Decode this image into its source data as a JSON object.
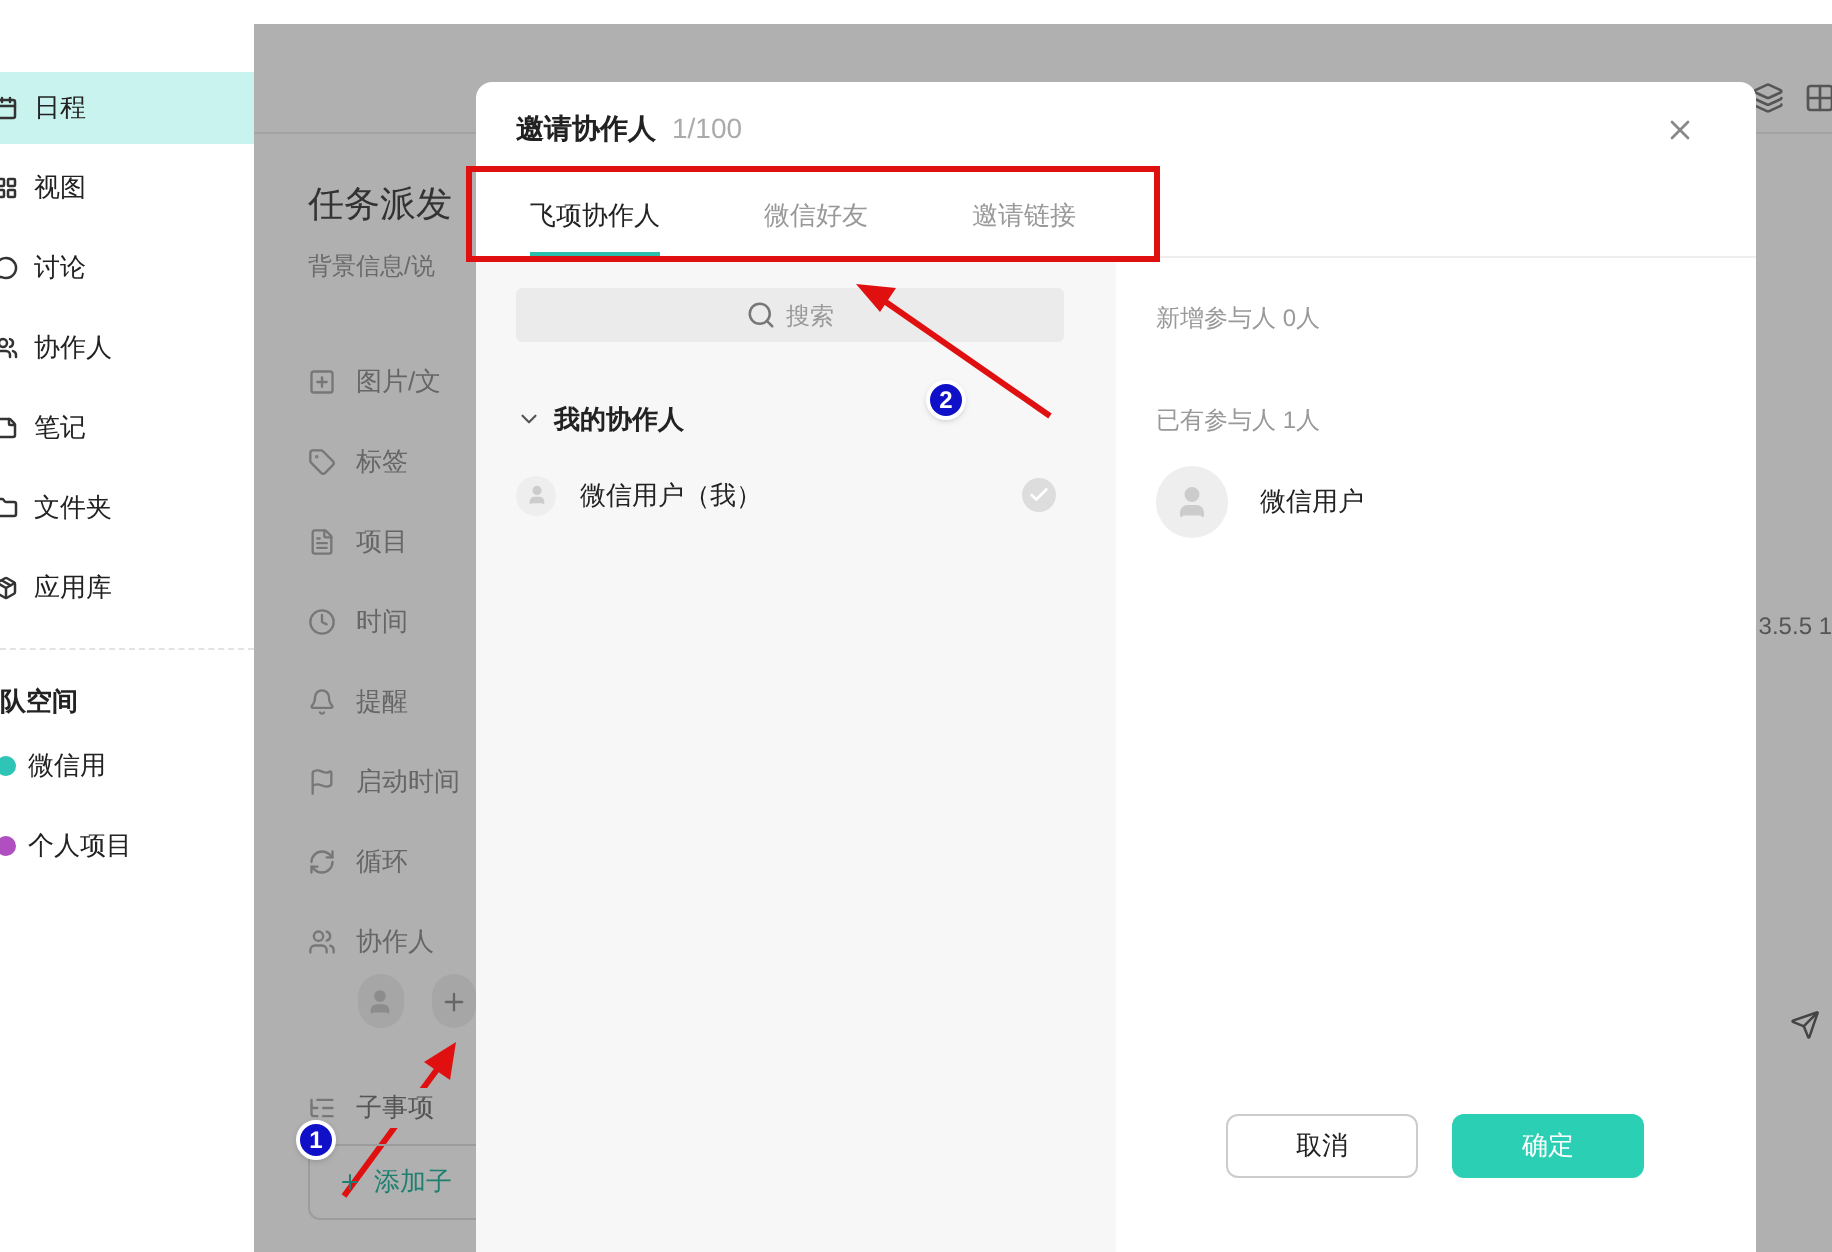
{
  "sidebar": {
    "items": [
      {
        "label": "日程",
        "kind": "calendar",
        "selected": true
      },
      {
        "label": "视图",
        "kind": "view",
        "selected": false
      },
      {
        "label": "讨论",
        "kind": "chat",
        "selected": false
      },
      {
        "label": "协作人",
        "kind": "people",
        "selected": false
      },
      {
        "label": "笔记",
        "kind": "note",
        "selected": false
      },
      {
        "label": "文件夹",
        "kind": "folder",
        "selected": false
      },
      {
        "label": "应用库",
        "kind": "apps",
        "selected": false
      }
    ],
    "section_title": "队空间",
    "projects": [
      {
        "label": "微信用",
        "color": "#2ec4b6"
      },
      {
        "label": "个人项目",
        "color": "#b04fc0"
      }
    ]
  },
  "task_panel": {
    "title": "任务派发",
    "description_placeholder": "背景信息/说",
    "fields": [
      {
        "label": "图片/文",
        "kind": "attachment"
      },
      {
        "label": "标签",
        "kind": "tag"
      },
      {
        "label": "项目",
        "kind": "project"
      },
      {
        "label": "时间",
        "kind": "time"
      },
      {
        "label": "提醒",
        "kind": "reminder"
      },
      {
        "label": "启动时间",
        "kind": "start"
      },
      {
        "label": "循环",
        "kind": "repeat"
      },
      {
        "label": "协作人",
        "kind": "people"
      }
    ],
    "subtask_label": "子事项",
    "add_subtask": "添加子",
    "version_text": "3.5.5 1"
  },
  "dialog": {
    "title": "邀请协作人",
    "count": "1/100",
    "tabs": [
      {
        "label": "飞项协作人",
        "selected": true
      },
      {
        "label": "微信好友",
        "selected": false
      },
      {
        "label": "邀请链接",
        "selected": false
      }
    ],
    "search": {
      "placeholder": "搜索"
    },
    "group": {
      "label": "我的协作人",
      "expanded": true,
      "members": [
        {
          "name": "微信用户（我）",
          "checked": true
        }
      ]
    },
    "new_participants": "新增参与人 0人",
    "existing_participants": "已有参与人 1人",
    "participants": [
      {
        "name": "微信用户"
      }
    ],
    "buttons": [
      "取消",
      "确定"
    ]
  },
  "annotations": [
    {
      "label": "1"
    },
    {
      "label": "2"
    }
  ]
}
